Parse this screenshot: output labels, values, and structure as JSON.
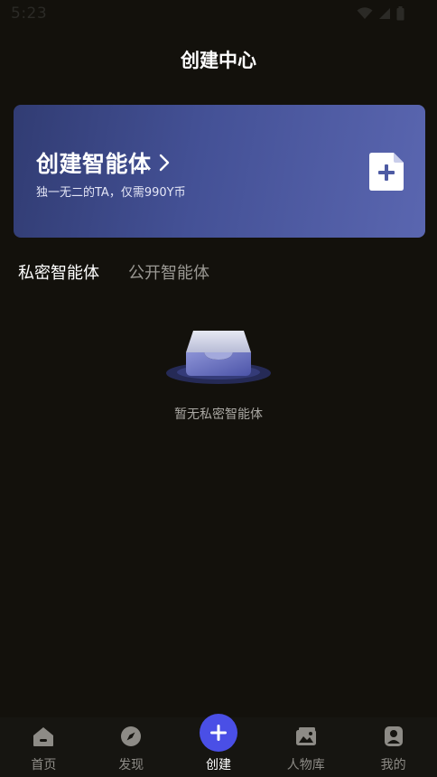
{
  "status": {
    "time": "5:23"
  },
  "header": {
    "title": "创建中心"
  },
  "banner": {
    "title": "创建智能体",
    "subtitle": "独一无二的TA，仅需990Y币",
    "icon": "add-document-icon",
    "chevron": "chevron-right-icon"
  },
  "tabs": [
    {
      "label": "私密智能体",
      "active": true
    },
    {
      "label": "公开智能体",
      "active": false
    }
  ],
  "empty": {
    "text": "暂无私密智能体",
    "icon": "empty-box-icon"
  },
  "tabbar": {
    "items": [
      {
        "label": "首页",
        "icon": "home-icon",
        "active": false
      },
      {
        "label": "发现",
        "icon": "compass-icon",
        "active": false
      },
      {
        "label": "创建",
        "icon": "plus-icon",
        "active": true
      },
      {
        "label": "人物库",
        "icon": "gallery-icon",
        "active": false
      },
      {
        "label": "我的",
        "icon": "profile-icon",
        "active": false
      }
    ]
  },
  "colors": {
    "background": "#13110c",
    "banner_start": "#313c73",
    "banner_end": "#5a66b0",
    "accent": "#4a4fe6",
    "inactive_text": "#8d8b86"
  }
}
